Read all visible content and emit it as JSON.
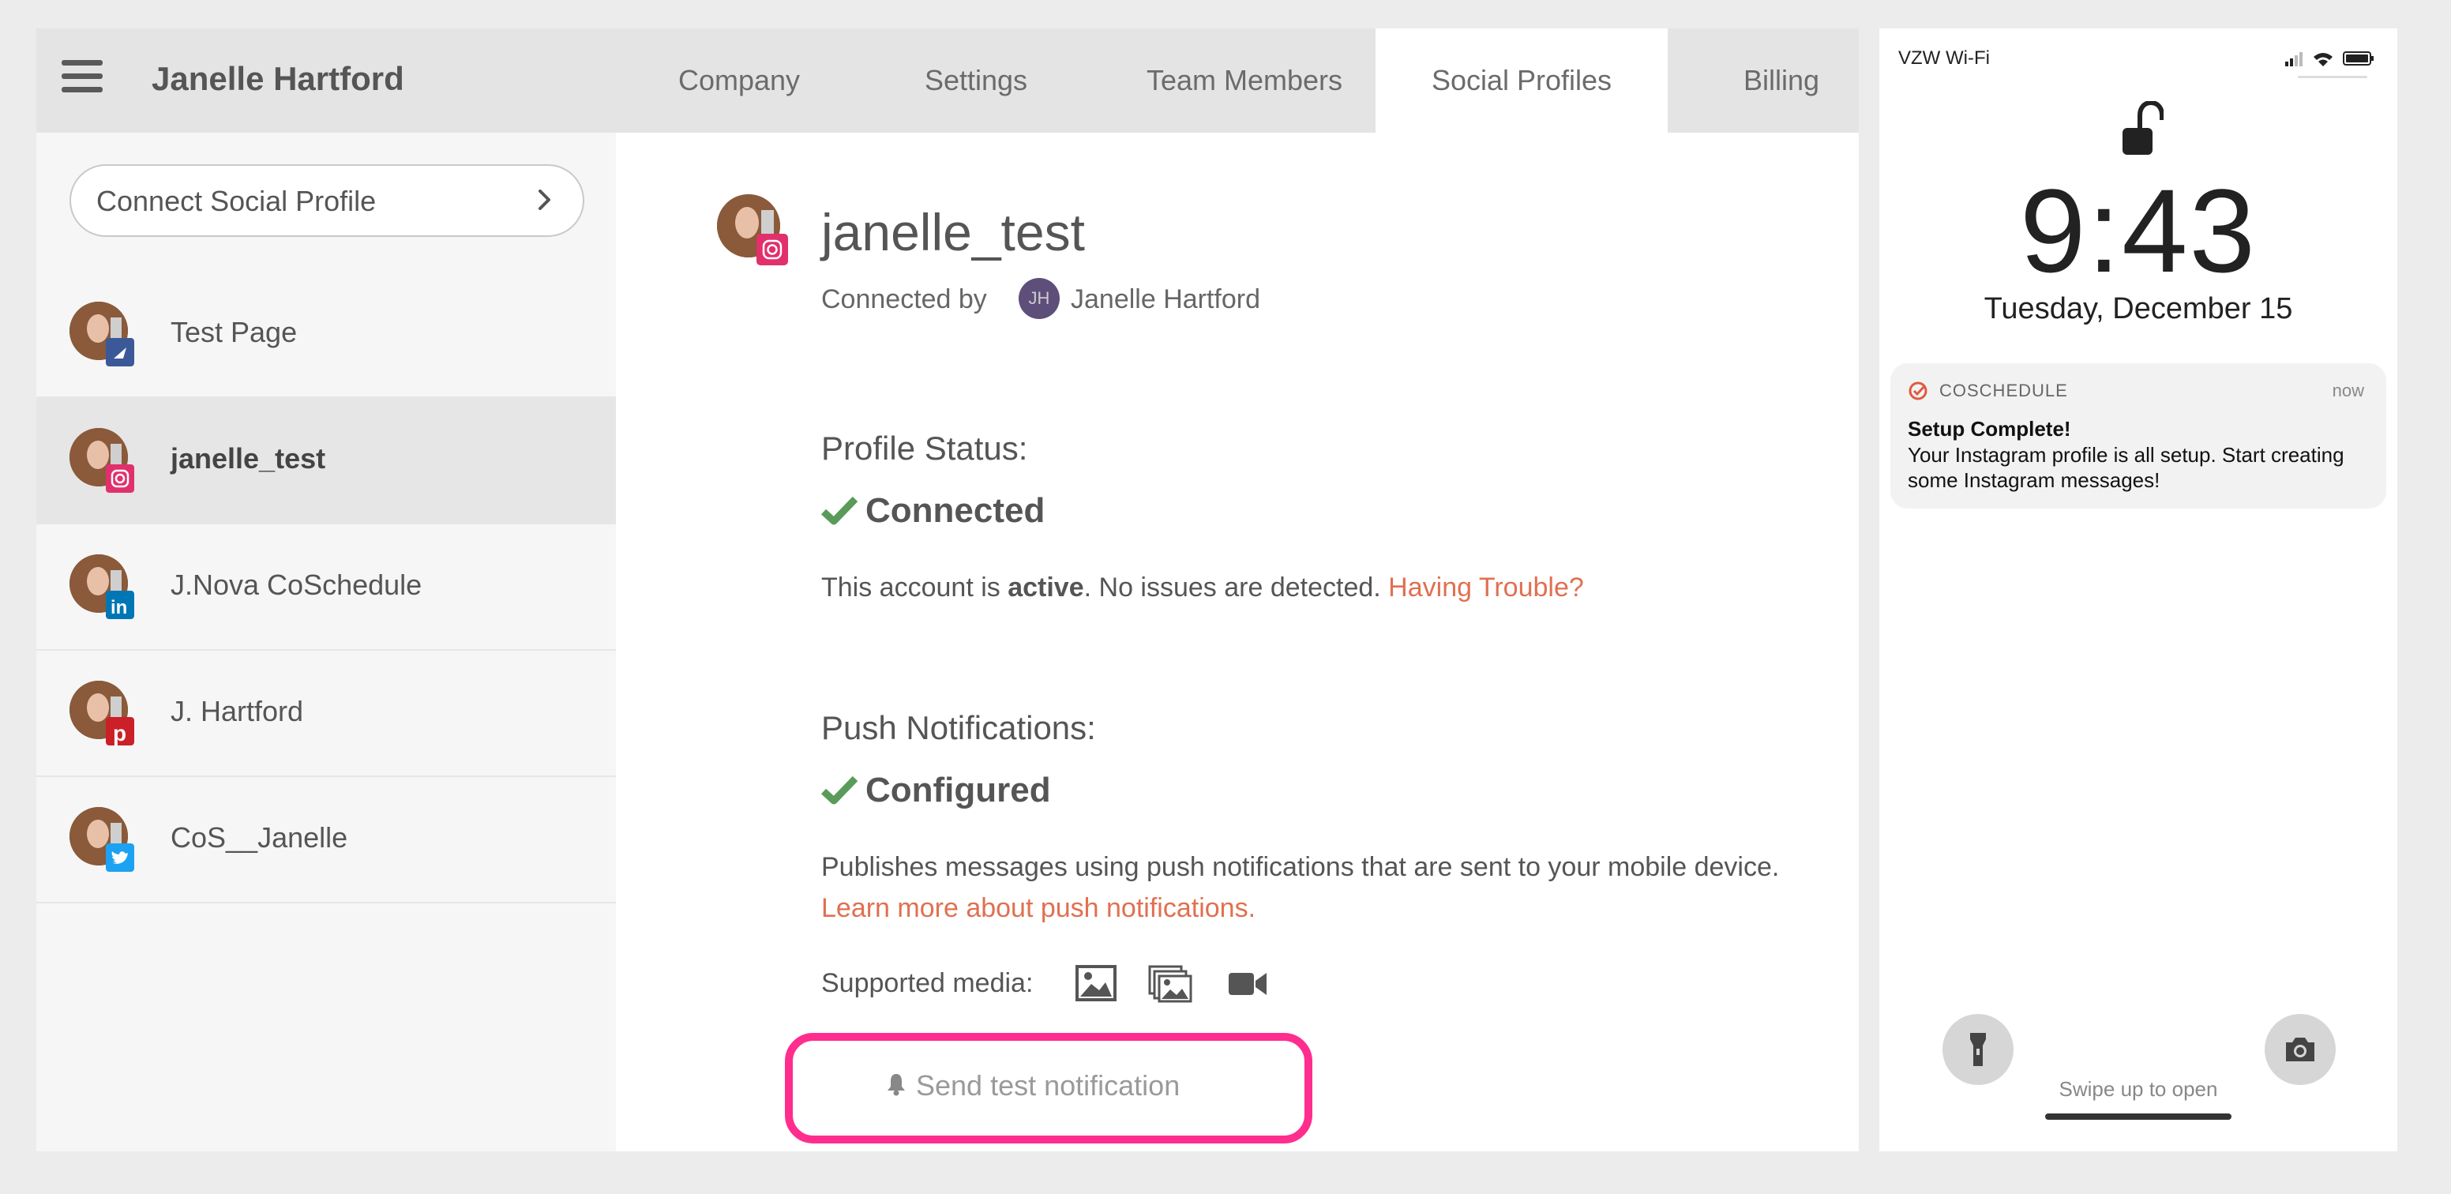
{
  "app": {
    "title": "Janelle Hartford",
    "tabs": [
      {
        "label": "Company",
        "active": false
      },
      {
        "label": "Settings",
        "active": false
      },
      {
        "label": "Team Members",
        "active": false
      },
      {
        "label": "Social Profiles",
        "active": true
      },
      {
        "label": "Billing",
        "active": false
      }
    ]
  },
  "sidebar": {
    "connect_label": "Connect Social Profile",
    "items": [
      {
        "name": "Test Page",
        "network": "facebook",
        "badge_color": "#3b5998",
        "active": false
      },
      {
        "name": "janelle_test",
        "network": "instagram",
        "badge_color": "#e1306c",
        "active": true
      },
      {
        "name": "J.Nova CoSchedule",
        "network": "linkedin",
        "badge_color": "#0077b5",
        "active": false
      },
      {
        "name": "J. Hartford",
        "network": "pinterest",
        "badge_color": "#cb2027",
        "active": false
      },
      {
        "name": "CoS__Janelle",
        "network": "twitter",
        "badge_color": "#1da1f2",
        "active": false
      }
    ]
  },
  "profile": {
    "name": "janelle_test",
    "connected_by_label": "Connected by",
    "connected_user_initials": "JH",
    "connected_user": "Janelle Hartford",
    "status_heading": "Profile Status:",
    "status_value": "Connected",
    "status_text_prefix": "This account is ",
    "status_text_bold": "active",
    "status_text_suffix": ". No issues are detected. ",
    "trouble_link": "Having Trouble?",
    "push_heading": "Push Notifications:",
    "push_value": "Configured",
    "push_text": "Publishes messages using push notifications that are sent to your mobile device. ",
    "push_link": "Learn more about push notifications.",
    "media_label": "Supported media:",
    "media_icons": [
      "image-icon",
      "multi-image-icon",
      "video-icon"
    ],
    "send_test_label": "Send test notification"
  },
  "phone": {
    "carrier": "VZW Wi-Fi",
    "time": "9:43",
    "date": "Tuesday, December 15",
    "notification": {
      "app": "COSCHEDULE",
      "time": "now",
      "title": "Setup Complete!",
      "body": "Your Instagram profile is all setup. Start creating some Instagram messages!"
    },
    "swipe_text": "Swipe up to open"
  },
  "colors": {
    "accent_link": "#e07050",
    "highlight": "#ff2d8e",
    "check": "#5a9a5a"
  }
}
